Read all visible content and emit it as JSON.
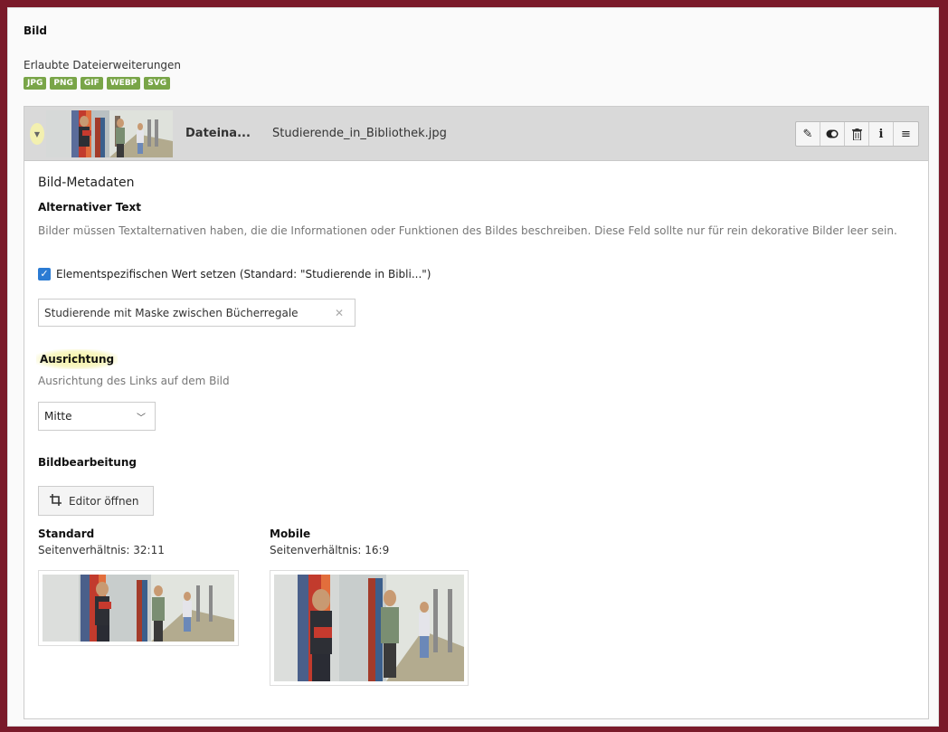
{
  "field": {
    "title": "Bild",
    "allowed_label": "Erlaubte Dateierweiterungen",
    "extensions": [
      "JPG",
      "PNG",
      "GIF",
      "WEBP",
      "SVG"
    ]
  },
  "file": {
    "label": "Dateina...",
    "name": "Studierende_in_Bibliothek.jpg",
    "actions": [
      "pencil-icon",
      "toggle-icon",
      "trash-icon",
      "info-icon",
      "menu-icon"
    ]
  },
  "metadata": {
    "heading": "Bild-Metadaten",
    "alt": {
      "label": "Alternativer Text",
      "description": "Bilder müssen Textalternativen haben, die die Informationen oder Funktionen des Bildes beschreiben. Diese Feld sollte nur für rein dekorative Bilder leer sein.",
      "checkbox_label": "Elementspezifischen Wert setzen (Standard: \"Studierende in Bibli...\")",
      "checked": true,
      "value": "Studierende mit Maske zwischen Bücherregale"
    },
    "alignment": {
      "label": "Ausrichtung",
      "description": "Ausrichtung des Links auf dem Bild",
      "selected": "Mitte"
    }
  },
  "editing": {
    "heading": "Bildbearbeitung",
    "button_label": "Editor öffnen",
    "variants": [
      {
        "title": "Standard",
        "ratio": "Seitenverhältnis: 32:11"
      },
      {
        "title": "Mobile",
        "ratio": "Seitenverhältnis: 16:9"
      }
    ]
  },
  "colors": {
    "frame": "#7a1a2a",
    "badge": "#79a548",
    "checkbox": "#2b7bd3"
  }
}
